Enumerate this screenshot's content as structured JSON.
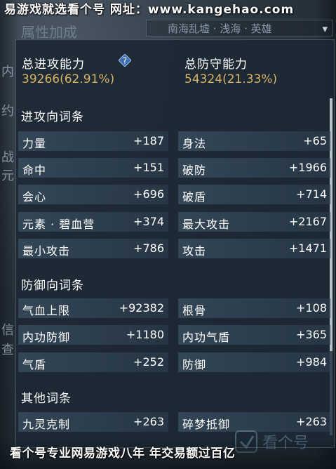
{
  "banner": {
    "text": "易游戏就选看个号  网址：www.kangehao.com"
  },
  "underlay": {
    "title": "属性加成",
    "zone": "南海乱墟 · 浅海 · 英雄",
    "side_glyphs": [
      "内",
      "约",
      "战",
      "元",
      "信",
      "查"
    ]
  },
  "summary": {
    "attack_label": "总进攻能力",
    "attack_value": "39266(62.91%)",
    "defense_label": "总防守能力",
    "defense_value": "54324(21.33%)"
  },
  "sections": {
    "attack": {
      "title": "进攻向词条",
      "rows": [
        {
          "l_name": "力量",
          "l_val": "+187",
          "r_name": "身法",
          "r_val": "+65"
        },
        {
          "l_name": "命中",
          "l_val": "+151",
          "r_name": "破防",
          "r_val": "+1966"
        },
        {
          "l_name": "会心",
          "l_val": "+696",
          "r_name": "破盾",
          "r_val": "+714"
        },
        {
          "l_name": "元素 · 碧血营",
          "l_val": "+374",
          "r_name": "最大攻击",
          "r_val": "+2167"
        },
        {
          "l_name": "最小攻击",
          "l_val": "+786",
          "r_name": "攻击",
          "r_val": "+1471"
        }
      ]
    },
    "defense": {
      "title": "防御向词条",
      "rows": [
        {
          "l_name": "气血上限",
          "l_val": "+92382",
          "r_name": "根骨",
          "r_val": "+108"
        },
        {
          "l_name": "内功防御",
          "l_val": "+1180",
          "r_name": "内功气盾",
          "r_val": "+365"
        },
        {
          "l_name": "气盾",
          "l_val": "+252",
          "r_name": "防御",
          "r_val": "+984"
        }
      ]
    },
    "other": {
      "title": "其他词条",
      "rows": [
        {
          "l_name": "九灵克制",
          "l_val": "+263",
          "r_name": "碎梦抵御",
          "r_val": "+263"
        }
      ]
    }
  },
  "footer": {
    "text": "看个号专业网易游戏八年  年交易额过百亿"
  },
  "watermark": {
    "text": "看个号"
  },
  "colors": {
    "accent_value": "#d8b265",
    "panel_bg": "#1c2834",
    "row_bg": "#465f73"
  }
}
